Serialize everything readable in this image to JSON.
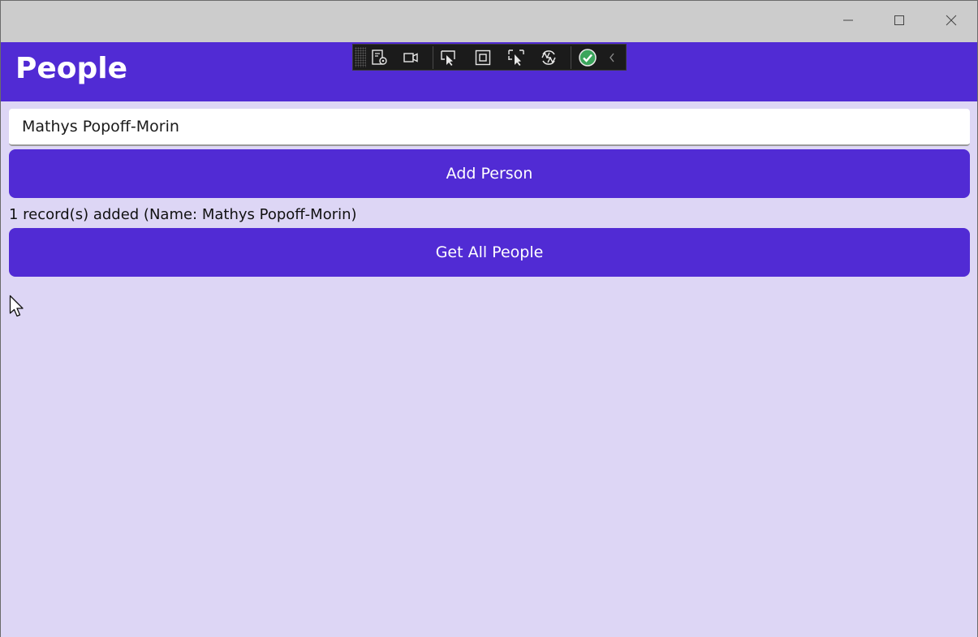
{
  "window": {
    "controls": [
      "minimize-icon",
      "maximize-icon",
      "close-icon"
    ]
  },
  "app": {
    "title": "People"
  },
  "devbar": {
    "icons": [
      "live-visual-tree-icon",
      "record-icon",
      "select-element-icon",
      "display-layout-adorners-icon",
      "track-focus-icon",
      "hot-reload-icon",
      "binding-check-icon",
      "collapse-chevron-icon"
    ]
  },
  "form": {
    "name_value": "Mathys Popoff-Morin",
    "add_label": "Add Person",
    "status_text": "1 record(s) added (Name: Mathys Popoff-Morin)",
    "get_all_label": "Get All People"
  },
  "colors": {
    "accent": "#512bd4",
    "background": "#ddd6f5",
    "titlebar": "#cccccc"
  }
}
